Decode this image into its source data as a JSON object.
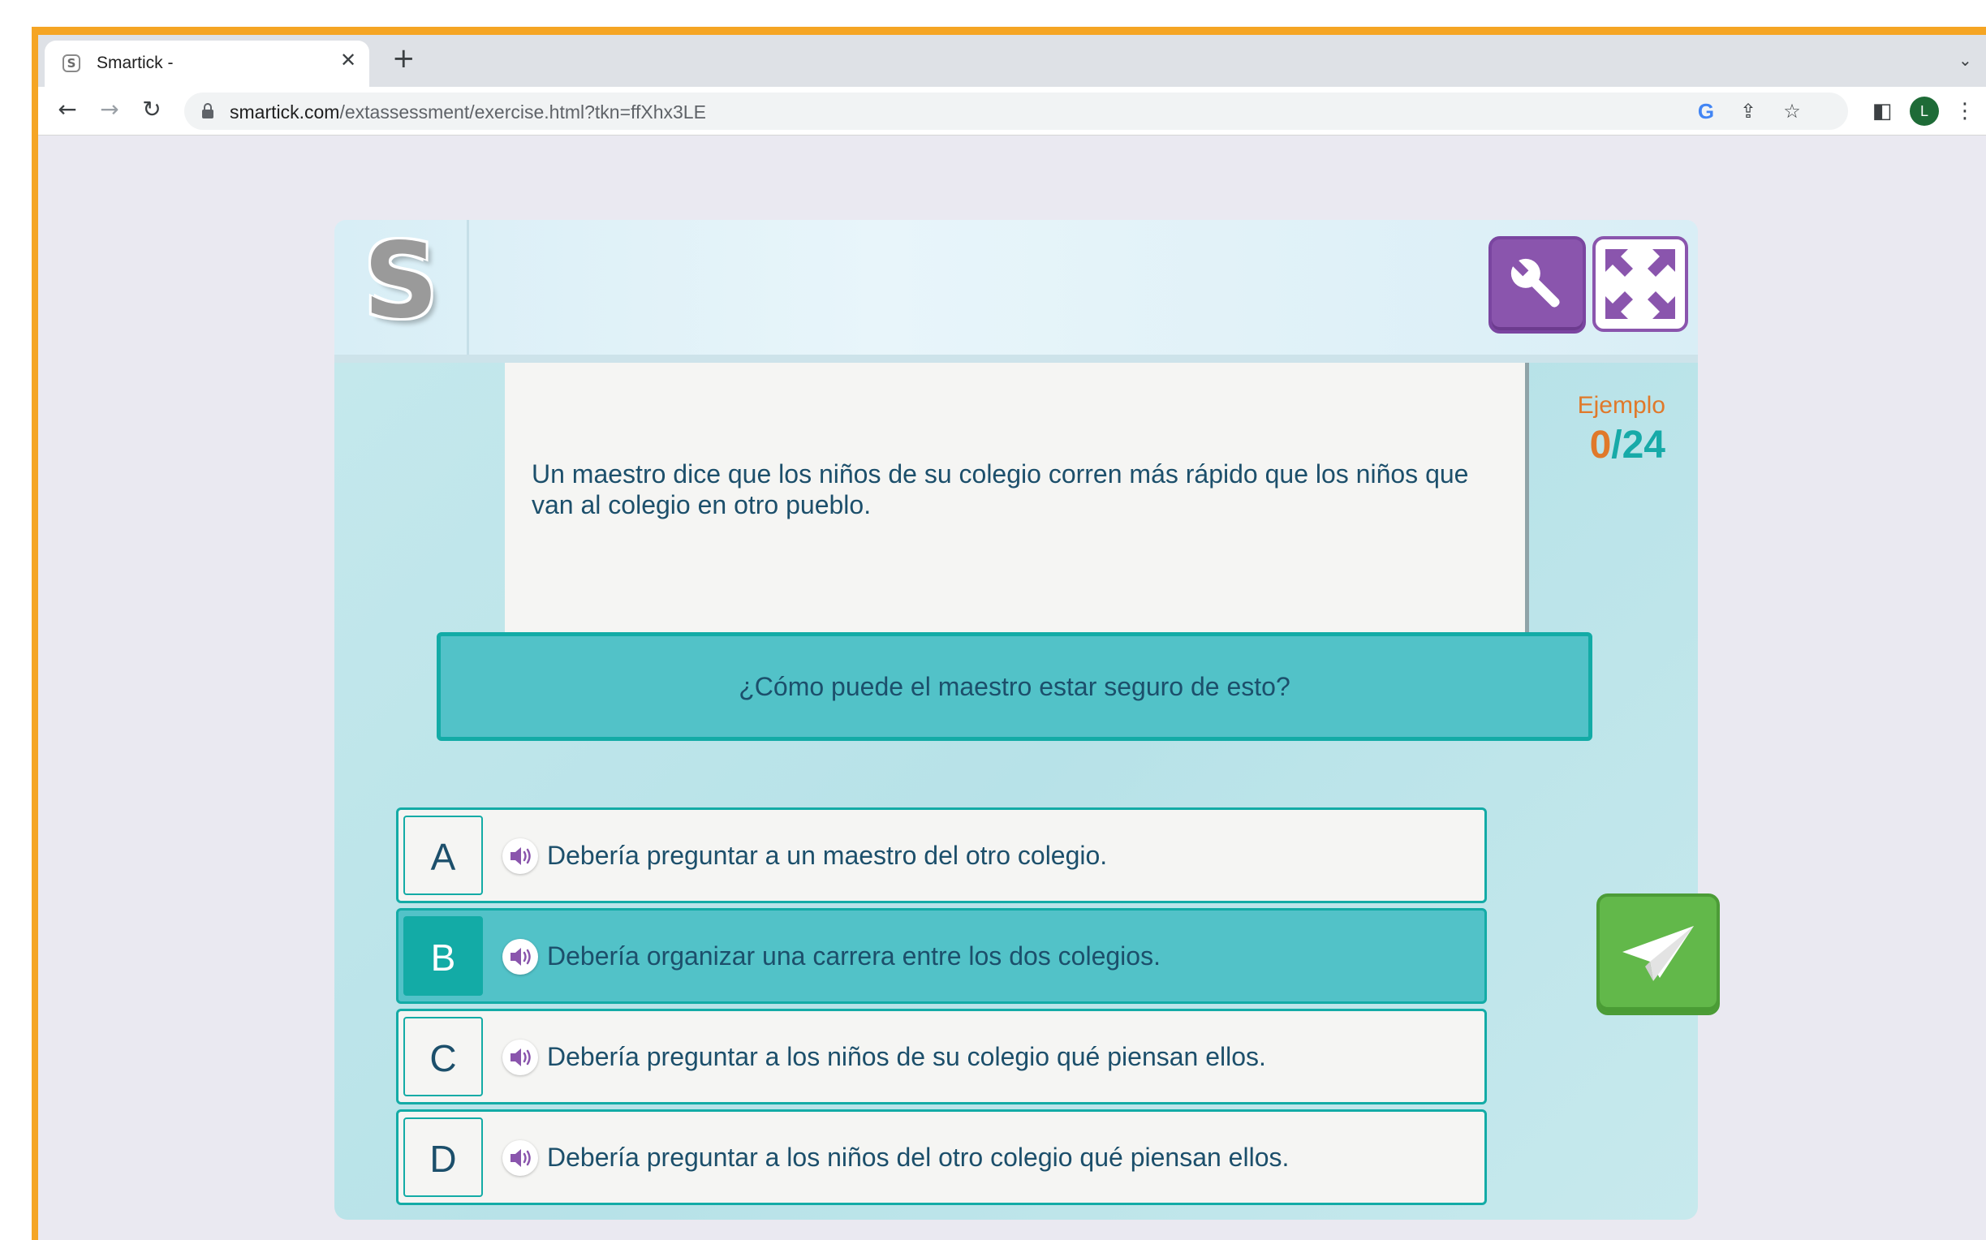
{
  "browser": {
    "tab": {
      "title": "Smartick -",
      "favicon": "S",
      "close": "✕"
    },
    "new_tab": "+",
    "nav": {
      "back": "←",
      "forward": "→",
      "reload": "↻"
    },
    "url": {
      "host": "smartick.com",
      "path": "/extassessment/exercise.html?tkn=ffXhx3LE"
    },
    "omnibox_icons": {
      "google": "G",
      "share": "⇪",
      "bookmark": "☆"
    },
    "toolbar_icons": {
      "side_panel": "◧",
      "menu": "⋮",
      "tab_menu": "⌄"
    },
    "profile_initial": "L"
  },
  "exercise": {
    "logo": "S",
    "counter": {
      "label": "Ejemplo",
      "current": "0",
      "separator": "/",
      "total": "24"
    },
    "reading": "Un maestro dice que los niños de su colegio corren más rápido que los niños que van al colegio en otro pueblo.",
    "question": "¿Cómo puede el maestro estar seguro de esto?",
    "options": [
      {
        "letter": "A",
        "text": "Debería preguntar a un maestro del otro colegio.",
        "selected": false
      },
      {
        "letter": "B",
        "text": "Debería organizar una carrera entre los dos colegios.",
        "selected": true
      },
      {
        "letter": "C",
        "text": "Debería preguntar a los niños de su colegio qué piensan ellos.",
        "selected": false
      },
      {
        "letter": "D",
        "text": "Debería preguntar a los niños del otro colegio qué piensan ellos.",
        "selected": false
      }
    ]
  },
  "colors": {
    "frame_orange": "#f5a524",
    "teal": "#13aba6",
    "teal_light": "#52c2c8",
    "purple": "#8a55ad",
    "green": "#62b84a",
    "text_blue": "#1c4f6b",
    "orange_text": "#e0792a"
  }
}
